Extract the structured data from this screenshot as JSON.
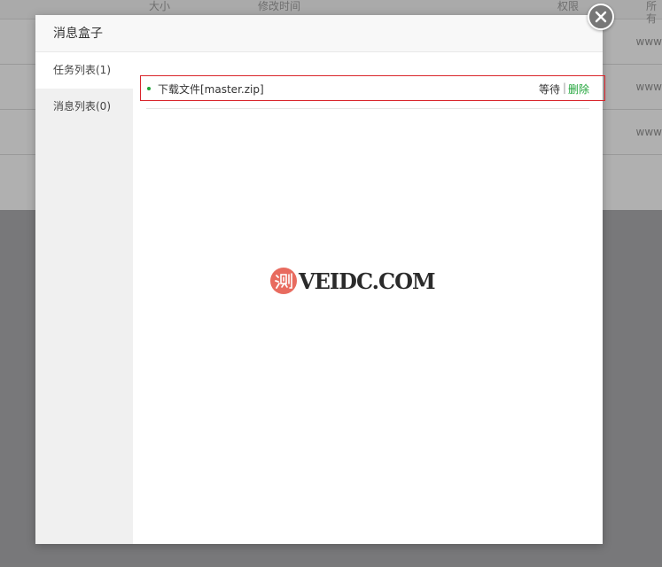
{
  "background": {
    "columns": [
      "大小",
      "修改时间",
      "权限",
      "所有"
    ],
    "rows": [
      {
        "owner": "www"
      },
      {
        "owner": "www"
      },
      {
        "owner": "www"
      }
    ]
  },
  "dialog": {
    "title": "消息盒子",
    "tabs": [
      {
        "label": "任务列表(1)"
      },
      {
        "label": "消息列表(0)"
      }
    ],
    "tasks": [
      {
        "name": "下载文件[master.zip]",
        "status": "等待",
        "separator": "|",
        "delete_label": "删除"
      }
    ]
  },
  "watermark": {
    "badge": "测",
    "text": "VEIDC.COM"
  },
  "colors": {
    "accent_green": "#20a53a",
    "highlight_red": "#d9242b"
  },
  "icons": {
    "close": "close-icon",
    "status": "status-dot-icon"
  }
}
